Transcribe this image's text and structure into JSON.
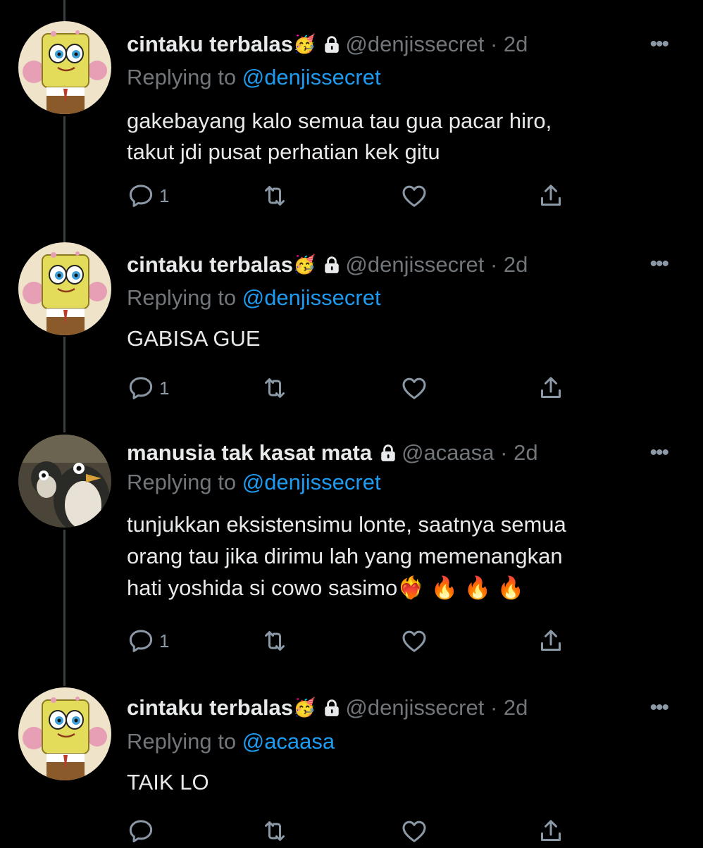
{
  "colors": {
    "background": "#000000",
    "text": "#e7e9ea",
    "muted": "#71767b",
    "mention": "#1d9bf0",
    "thread": "#3a3f44"
  },
  "tweets": [
    {
      "name": "cintaku terbalas",
      "emoji": "🥳",
      "handle": "@denjissecret",
      "dot": "·",
      "time": "2d",
      "replying_prefix": "Replying to ",
      "replying_to": "@denjissecret",
      "text": "gakebayang kalo semua tau gua pacar hiro,\ntakut jdi pusat perhatian kek gitu",
      "reply_count": "1",
      "avatar": "spongebob-avatar"
    },
    {
      "name": "cintaku terbalas",
      "emoji": "🥳",
      "handle": "@denjissecret",
      "dot": "·",
      "time": "2d",
      "replying_prefix": "Replying to ",
      "replying_to": "@denjissecret",
      "text": "GABISA GUE",
      "reply_count": "1",
      "avatar": "spongebob-avatar"
    },
    {
      "name": "manusia tak kasat mata",
      "emoji": "",
      "handle": "@acaasa",
      "dot": "·",
      "time": "2d",
      "replying_prefix": "Replying to ",
      "replying_to": "@denjissecret",
      "text": "tunjukkan eksistensimu lonte, saatnya semua\norang tau jika dirimu lah yang memenangkan\nhati yoshida si cowo sasimo❤️‍🔥 🔥 🔥 🔥",
      "reply_count": "1",
      "avatar": "penguin-avatar"
    },
    {
      "name": "cintaku terbalas",
      "emoji": "🥳",
      "handle": "@denjissecret",
      "dot": "·",
      "time": "2d",
      "replying_prefix": "Replying to ",
      "replying_to": "@acaasa",
      "text": "TAIK LO",
      "reply_count": "",
      "avatar": "spongebob-avatar"
    }
  ],
  "icons": {
    "reply": "reply-icon",
    "retweet": "retweet-icon",
    "like": "heart-icon",
    "share": "share-icon",
    "more": "more-icon",
    "lock": "lock-icon"
  },
  "more_glyph": "•••"
}
